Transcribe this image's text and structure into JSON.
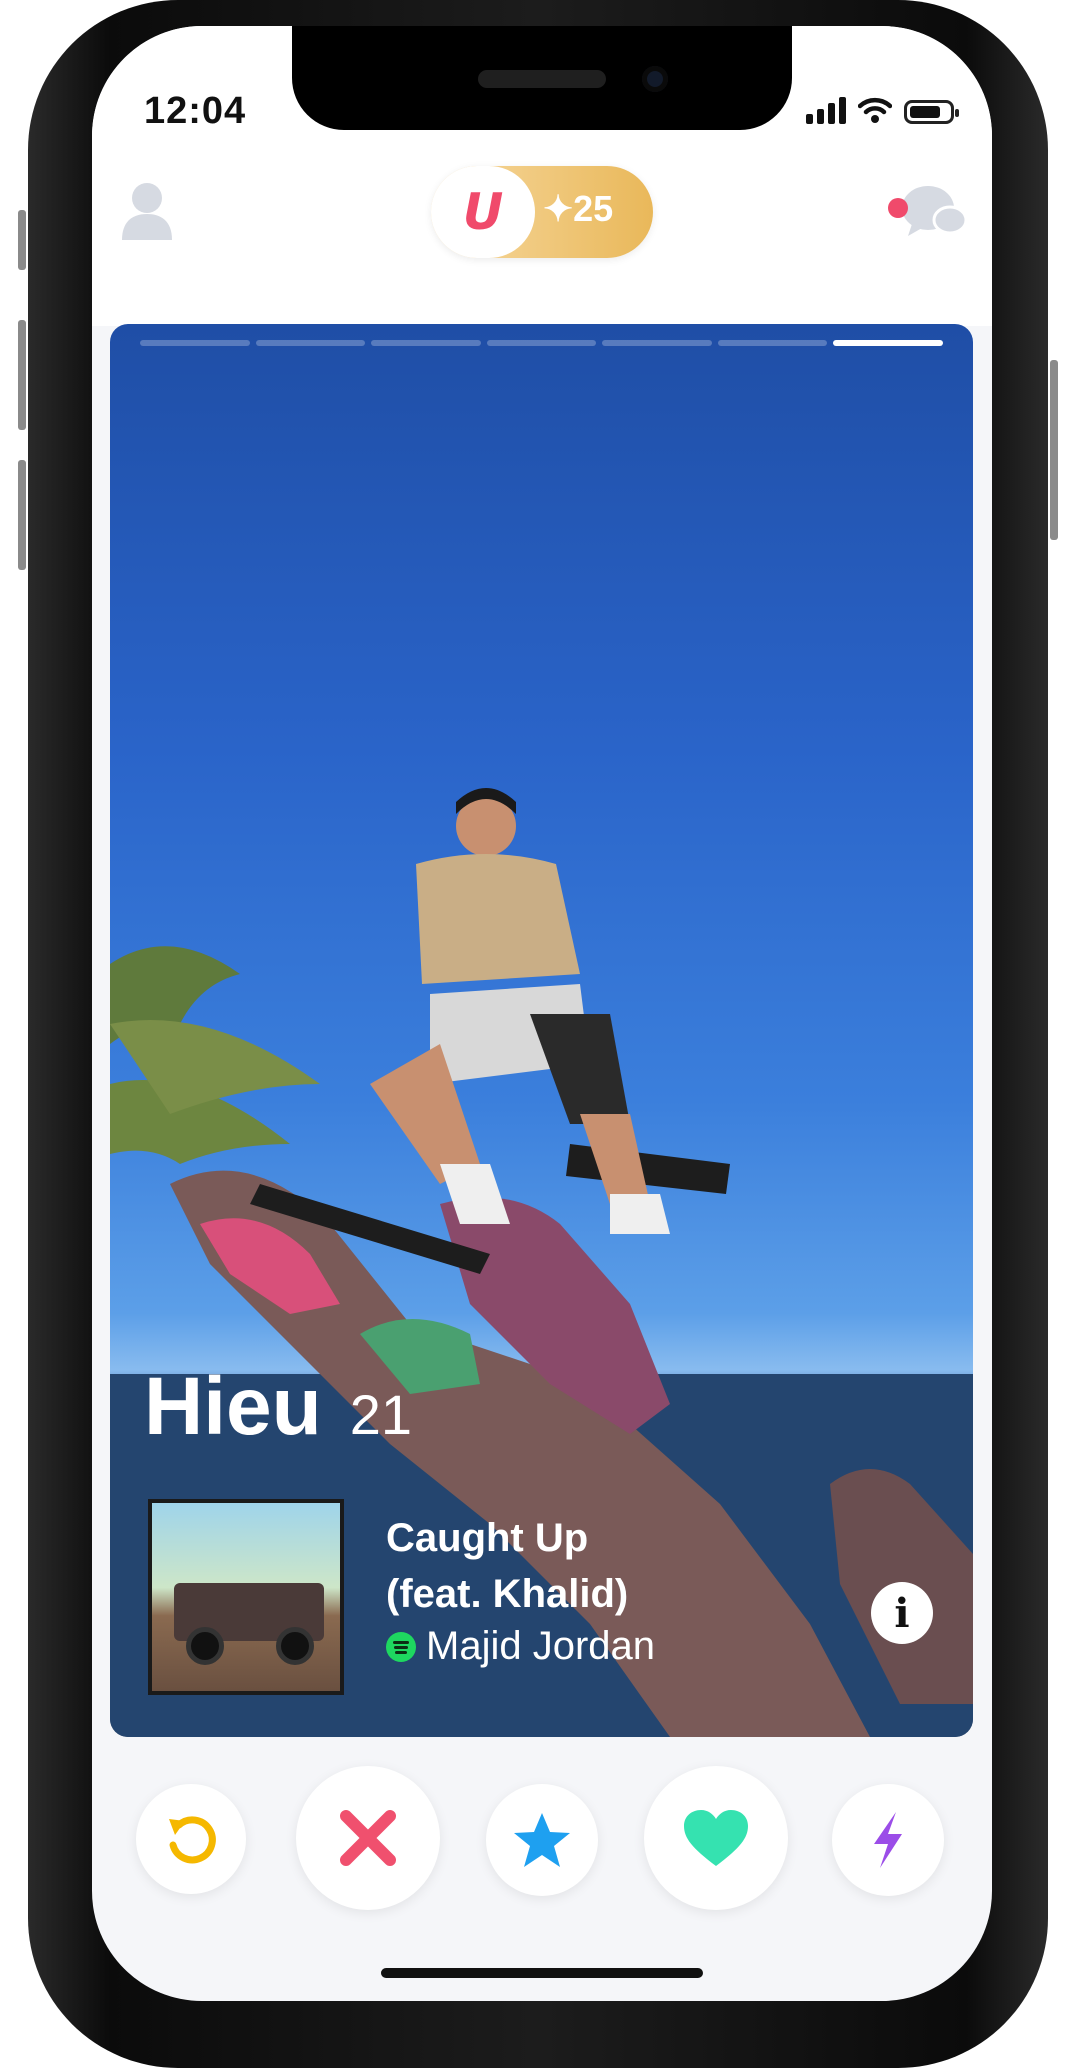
{
  "status_bar": {
    "time": "12:04"
  },
  "header": {
    "logo_letter": "U",
    "boost_count": "✦25"
  },
  "card": {
    "name": "Hieu",
    "age": "21",
    "photo_count": 7,
    "active_photo_index": 6,
    "song": {
      "title_line1": "Caught Up",
      "title_line2": "(feat. Khalid)",
      "artist": "Majid Jordan"
    },
    "info_label": "i"
  },
  "actions": [
    {
      "name": "rewind-button",
      "icon": "rewind-icon",
      "color": "#f5b800"
    },
    {
      "name": "nope-button",
      "icon": "x-icon",
      "color": "#f0506e"
    },
    {
      "name": "super-like-button",
      "icon": "star-icon",
      "color": "#1ea0f0"
    },
    {
      "name": "like-button",
      "icon": "heart-icon",
      "color": "#35e2b0"
    },
    {
      "name": "boost-button",
      "icon": "bolt-icon",
      "color": "#9b4de8"
    }
  ],
  "colors": {
    "accent": "#f04a6b",
    "gold": "#e9b85a"
  }
}
